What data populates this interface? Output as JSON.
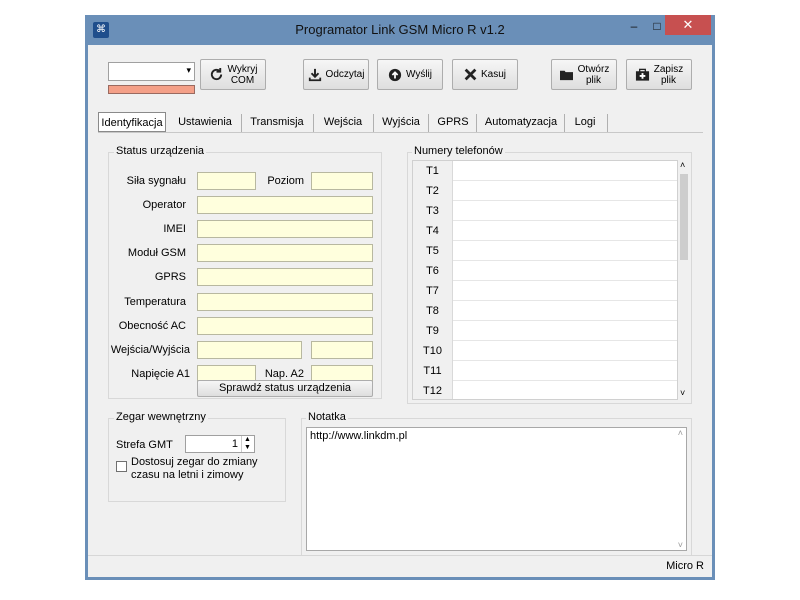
{
  "window": {
    "title": "Programator Link GSM Micro R v1.2"
  },
  "toolbar": {
    "detect_com": "Wykryj\nCOM",
    "read": "Odczytaj",
    "send": "Wyślij",
    "erase": "Kasuj",
    "open_file": "Otwórz\nplik",
    "save_file": "Zapisz\nplik"
  },
  "tabs": [
    "Identyfikacja",
    "Ustawienia",
    "Transmisja",
    "Wejścia",
    "Wyjścia",
    "GPRS",
    "Automatyzacja",
    "Logi"
  ],
  "status": {
    "group_title": "Status urządzenia",
    "signal_label": "Siła sygnału",
    "level_label": "Poziom",
    "operator_label": "Operator",
    "imei_label": "IMEI",
    "gsm_module_label": "Moduł GSM",
    "gprs_label": "GPRS",
    "temperature_label": "Temperatura",
    "ac_label": "Obecność AC",
    "io_label": "Wejścia/Wyjścia",
    "voltage_a1_label": "Napięcie A1",
    "voltage_a2_label": "Nap. A2",
    "check_button": "Sprawdź status urządzenia"
  },
  "phones": {
    "group_title": "Numery telefonów",
    "rows": [
      {
        "key": "T1",
        "value": ""
      },
      {
        "key": "T2",
        "value": ""
      },
      {
        "key": "T3",
        "value": ""
      },
      {
        "key": "T4",
        "value": ""
      },
      {
        "key": "T5",
        "value": ""
      },
      {
        "key": "T6",
        "value": ""
      },
      {
        "key": "T7",
        "value": ""
      },
      {
        "key": "T8",
        "value": ""
      },
      {
        "key": "T9",
        "value": ""
      },
      {
        "key": "T10",
        "value": ""
      },
      {
        "key": "T11",
        "value": ""
      },
      {
        "key": "T12",
        "value": ""
      }
    ]
  },
  "clock": {
    "group_title": "Zegar wewnętrzny",
    "gmt_label": "Strefa GMT",
    "gmt_value": "1",
    "dst_label": "Dostosuj zegar do zmiany\nczasu na letni i zimowy",
    "dst_checked": false
  },
  "note": {
    "group_title": "Notatka",
    "text": "http://www.linkdm.pl"
  },
  "statusbar": {
    "model": "Micro R"
  },
  "colors": {
    "titlebar": "#6a8fb8",
    "close": "#c75050",
    "field_bg": "#ffffdd",
    "progress": "#f4a088"
  }
}
